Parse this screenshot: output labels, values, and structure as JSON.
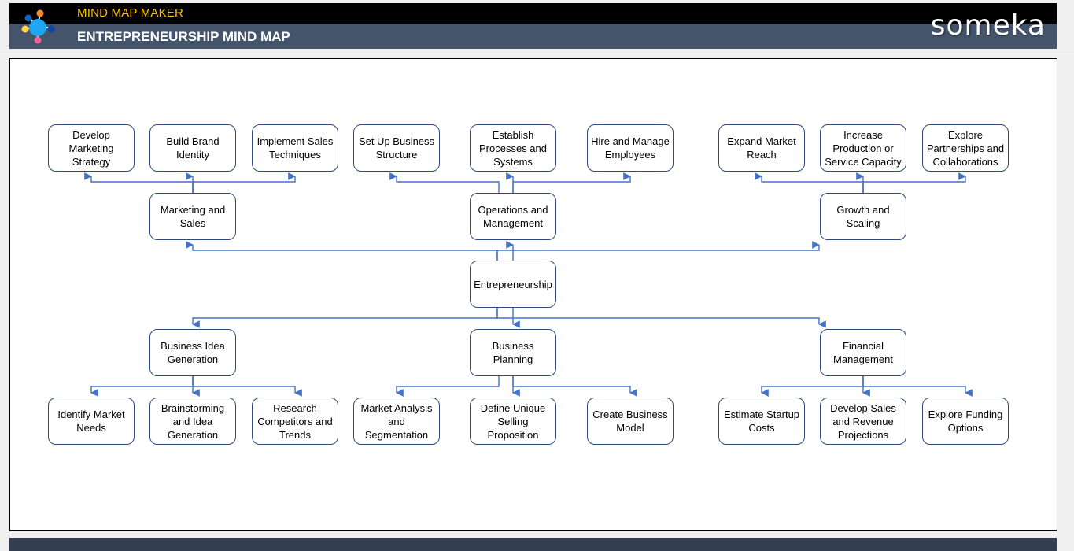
{
  "header": {
    "app_name": "MIND MAP MAKER",
    "page_title": "ENTREPRENEURSHIP MIND MAP",
    "brand": "someka",
    "logo_icon": "mind-map-icon"
  },
  "colors": {
    "header_top": "#000000",
    "header_bottom": "#44546a",
    "app_name": "#ffc000",
    "node_border": "#2f4b7c",
    "connector": "#4472c4",
    "footer": "#333f50"
  },
  "mindmap": {
    "root": "Entrepreneurship",
    "branches": [
      {
        "label": "Marketing and Sales",
        "direction": "up",
        "children": [
          "Develop Marketing Strategy",
          "Build Brand Identity",
          "Implement Sales Techniques"
        ]
      },
      {
        "label": "Operations and Management",
        "direction": "up",
        "children": [
          "Set Up Business Structure",
          "Establish Processes and Systems",
          "Hire and Manage Employees"
        ]
      },
      {
        "label": "Growth and Scaling",
        "direction": "up",
        "children": [
          "Expand Market Reach",
          "Increase Production or Service Capacity",
          "Explore Partnerships and Collaborations"
        ]
      },
      {
        "label": "Business Idea Generation",
        "direction": "down",
        "children": [
          "Identify Market Needs",
          "Brainstorming and Idea Generation",
          "Research Competitors and Trends"
        ]
      },
      {
        "label": "Business Planning",
        "direction": "down",
        "children": [
          "Market Analysis and Segmentation",
          "Define Unique Selling Proposition",
          "Create Business Model"
        ]
      },
      {
        "label": "Financial Management",
        "direction": "down",
        "children": [
          "Estimate Startup Costs",
          "Develop Sales and Revenue Projections",
          "Explore Funding Options"
        ]
      }
    ]
  }
}
